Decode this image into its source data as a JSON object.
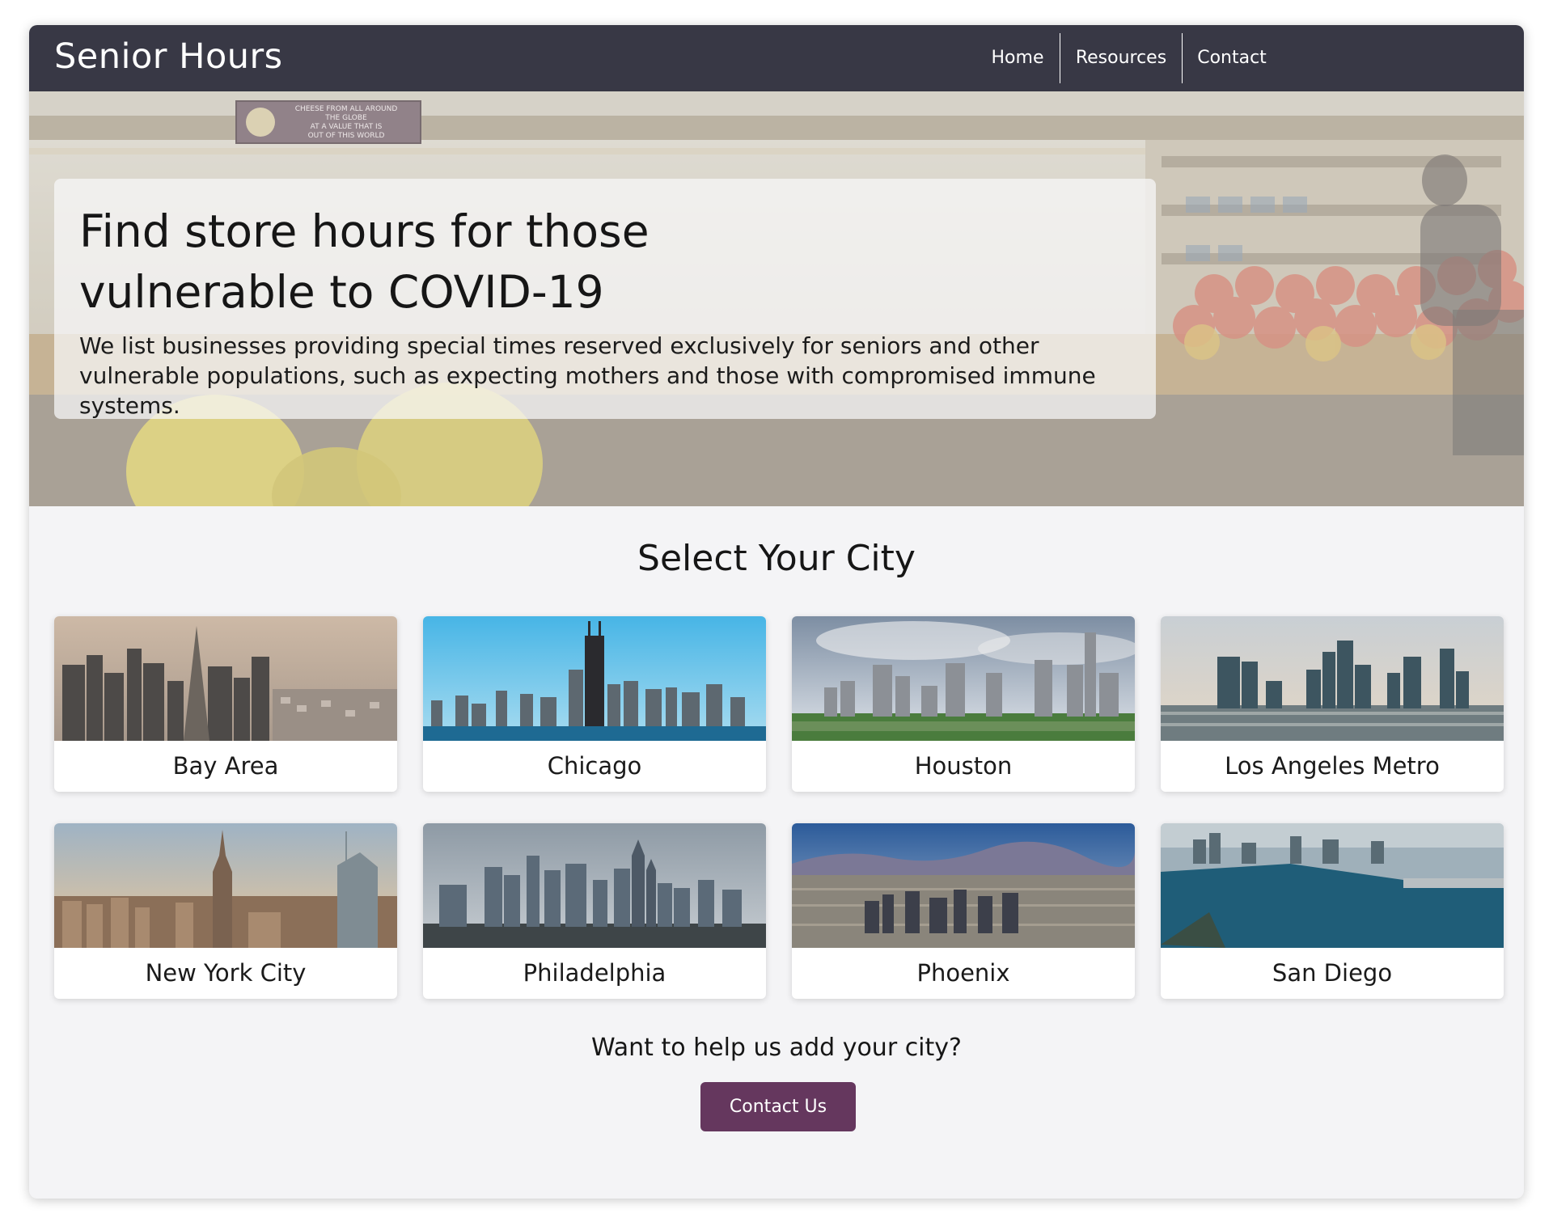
{
  "brand": "Senior Hours",
  "nav": {
    "home": "Home",
    "resources": "Resources",
    "contact": "Contact"
  },
  "hero": {
    "title": "Find store hours for those vulnerable to COVID-19",
    "subtitle": "We list businesses providing special times reserved exclusively for seniors and other vulnerable populations, such as expecting mothers and those with compromised immune systems.",
    "sign_text": [
      "CHEESE FROM ALL AROUND",
      "THE GLOBE",
      "AT A VALUE THAT IS",
      "OUT OF THIS WORLD"
    ]
  },
  "section_title": "Select Your City",
  "cities": [
    {
      "name": "Bay Area"
    },
    {
      "name": "Chicago"
    },
    {
      "name": "Houston"
    },
    {
      "name": "Los Angeles Metro"
    },
    {
      "name": "New York City"
    },
    {
      "name": "Philadelphia"
    },
    {
      "name": "Phoenix"
    },
    {
      "name": "San Diego"
    }
  ],
  "help_text": "Want to help us add your city?",
  "contact_button": "Contact Us",
  "colors": {
    "navbar": "#383845",
    "page_background": "#f4f4f6",
    "button": "#65375e",
    "button_text": "#ffffff"
  }
}
